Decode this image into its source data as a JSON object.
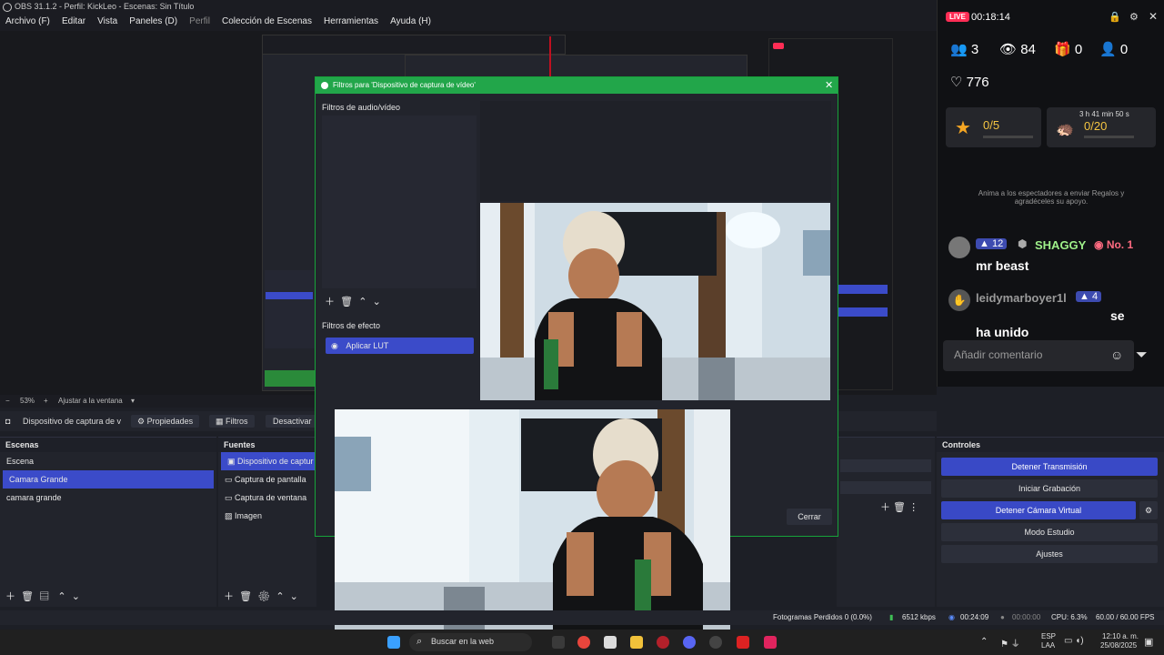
{
  "app": {
    "title": "OBS 31.1.2 - Perfil: KickLeo - Escenas: Sin Título"
  },
  "menu": [
    "Archivo (F)",
    "Editar",
    "Vista",
    "Paneles (D)",
    "Perfil",
    "Colección de Escenas",
    "Herramientas",
    "Ayuda (H)"
  ],
  "zoom": {
    "value": "53%",
    "fit": "Ajustar a la ventana"
  },
  "toolbar": {
    "source": "Dispositivo de captura de v",
    "properties": "Propiedades",
    "filters": "Filtros",
    "deactivate": "Desactivar"
  },
  "scenes": {
    "title": "Escenas",
    "items": [
      "Escena",
      "Camara Grande",
      "camara grande"
    ],
    "selected": 1
  },
  "sources": {
    "title": "Fuentes",
    "items": [
      "Dispositivo de captur",
      "Captura de pantalla",
      "Captura de ventana",
      "Imagen"
    ],
    "selected": 0
  },
  "controls": {
    "title": "Controles",
    "stop_stream": "Detener Transmisión",
    "start_rec": "Iniciar Grabación",
    "stop_vcam": "Detener Cámara Virtual",
    "studio": "Modo Estudio",
    "settings": "Ajustes"
  },
  "dialog": {
    "title": "Filtros para 'Dispositivo de captura de vídeo'",
    "av_filters": "Filtros de audio/vídeo",
    "effect_filters": "Filtros de efecto",
    "effect_items": [
      "Aplicar LUT"
    ],
    "close": "Cerrar"
  },
  "status": {
    "dropped": "Fotogramas Perdidos 0 (0.0%)",
    "kbps": "6512 kbps",
    "stream_time": "00:24:09",
    "rec_time": "00:00:00",
    "cpu": "CPU: 6.3%",
    "fps": "60.00 / 60.00 FPS"
  },
  "live": {
    "badge": "LIVE",
    "time": "00:18:14",
    "stats": {
      "viewers_group": "3",
      "views": "84",
      "gifts": "0",
      "followers": "0",
      "likes": "776"
    },
    "goal1": "0/5",
    "goal2_time": "3 h 41 min 50 s",
    "goal2": "0/20",
    "hint": "Anima a los espectadores a enviar Regalos y agradéceles su apoyo.",
    "chat": [
      {
        "level": "12",
        "name": "SHAGGY",
        "rank": "No. 1",
        "message": "mr beast"
      },
      {
        "name": "leidymarboyer1l",
        "level": "4",
        "message": "se ha unido"
      }
    ],
    "comment_placeholder": "Añadir comentario"
  },
  "taskbar": {
    "search": "Buscar en la web",
    "lang1": "ESP",
    "lang2": "LAA",
    "time": "12:10 a. m.",
    "date": "25/08/2025"
  },
  "colors": {
    "accent": "#3b4bc9",
    "dialog_green": "#22a64a",
    "live_red": "#ff2d55"
  }
}
